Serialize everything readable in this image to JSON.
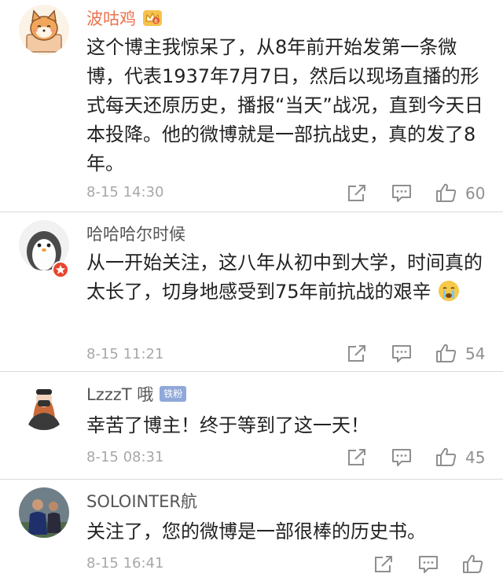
{
  "comments": [
    {
      "username": "波咕鸡",
      "text": "这个博主我惊呆了，从8年前开始发第一条微博，代表1937年7月7日，然后以现场直播的形式每天还原历史，播报“当天”战况，直到今天日本投降。他的微博就是一部抗战史，真的发了8年。",
      "time": "8-15 14:30",
      "likes": "60",
      "avatar_icon": "cartoon-shiba-dog-avatar",
      "badge_icon": "crown-vip-icon"
    },
    {
      "username": "哈哈哈尔时候",
      "text": "从一开始关注，这八年从初中到大学，时间真的太长了，切身地感受到75年前抗战的艰辛",
      "emoji_icon": "crying-face-icon",
      "time": "8-15 11:21",
      "likes": "54",
      "avatar_icon": "cartoon-penguin-avatar",
      "avatar_badge_icon": "red-star-verified-icon"
    },
    {
      "username": "LzzzT 哦",
      "fan_badge": "铁粉",
      "text": "幸苦了博主！终于等到了这一天！",
      "time": "8-15 08:31",
      "likes": "45",
      "avatar_icon": "woman-photo-avatar"
    },
    {
      "username": "SOLOINTER航",
      "text": "关注了，您的微博是一部很棒的历史书。",
      "time": "8-15 16:41",
      "avatar_icon": "football-player-photo-avatar"
    }
  ],
  "icons": {
    "share": "share-icon",
    "reply": "reply-icon",
    "like": "thumbs-up-icon"
  },
  "colors": {
    "username_highlight": "#eb7350",
    "meta_text": "#a8a8a8",
    "divider": "#d9d9d9"
  }
}
